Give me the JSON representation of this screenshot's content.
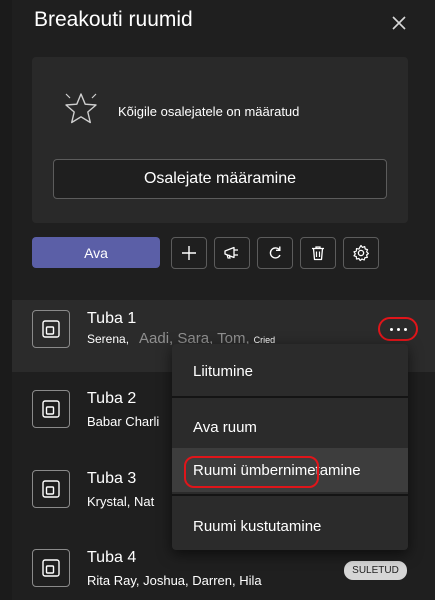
{
  "header": {
    "title": "Breakouti ruumid",
    "close_icon": "close-icon"
  },
  "assignment": {
    "icon": "star-icon",
    "status": "Kõigile osalejatele on määratud",
    "button_label": "Osalejate määramine"
  },
  "toolbar": {
    "open_label": "Ava",
    "accent_color": "#5b5fa7",
    "icons": [
      "add-icon",
      "megaphone-icon",
      "refresh-icon",
      "trash-icon",
      "settings-icon"
    ]
  },
  "rooms": [
    {
      "name": "Tuba 1",
      "members": "Serena,",
      "members_overlay": "Aadi, Sara, Tom,",
      "members_small": "Cried"
    },
    {
      "name": "Tuba 2",
      "members": "Babar Charli"
    },
    {
      "name": "Tuba 3",
      "members": "Krystal, Nat"
    },
    {
      "name": "Tuba 4",
      "members": "Rita Ray, Joshua, Darren, Hila",
      "badge": "SULETUD"
    }
  ],
  "context_menu": {
    "items": [
      "Liitumine",
      "Ava ruum",
      "Ruumi ümbernimetamine",
      "Ruumi kustutamine"
    ],
    "highlight_color": "#e0151a"
  }
}
